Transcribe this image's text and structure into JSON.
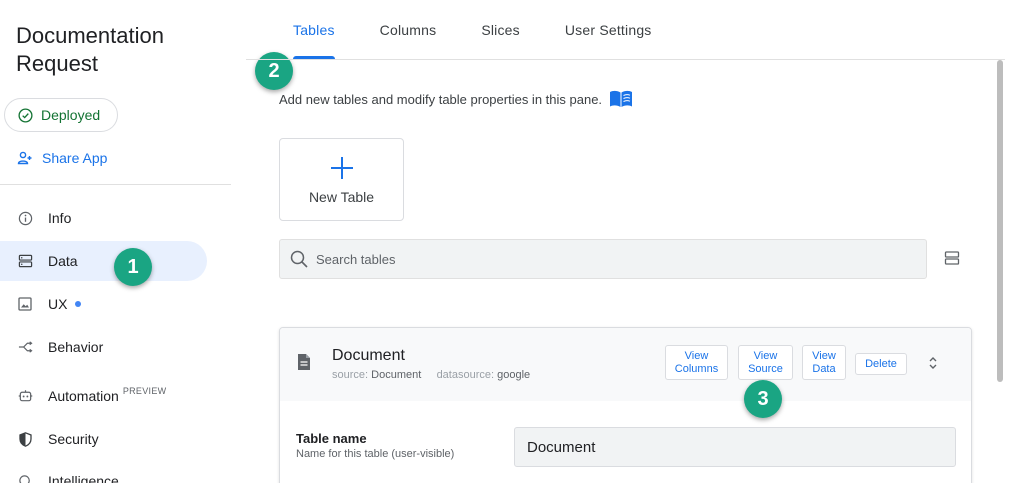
{
  "app": {
    "title": "Documentation Request"
  },
  "sidebar": {
    "status_label": "Deployed",
    "share_label": "Share App",
    "items": [
      {
        "label": "Info",
        "icon": "info-icon"
      },
      {
        "label": "Data",
        "icon": "data-icon",
        "active": true
      },
      {
        "label": "UX",
        "icon": "ux-icon",
        "dot": true
      },
      {
        "label": "Behavior",
        "icon": "behavior-icon"
      },
      {
        "label": "Automation",
        "icon": "automation-icon",
        "tag": "PREVIEW"
      },
      {
        "label": "Security",
        "icon": "security-icon"
      },
      {
        "label": "Intelligence",
        "icon": "intelligence-icon"
      }
    ]
  },
  "tabs": [
    {
      "label": "Tables",
      "active": true
    },
    {
      "label": "Columns"
    },
    {
      "label": "Slices"
    },
    {
      "label": "User Settings"
    }
  ],
  "pane": {
    "description": "Add new tables and modify table properties in this pane.",
    "new_table_label": "New Table",
    "search_placeholder": "Search tables"
  },
  "table_card": {
    "name": "Document",
    "source_label": "source:",
    "source_value": "Document",
    "datasource_label": "datasource:",
    "datasource_value": "google",
    "buttons": {
      "view_columns": [
        "View",
        "Columns"
      ],
      "view_source": [
        "View",
        "Source"
      ],
      "view_data": [
        "View",
        "Data"
      ],
      "delete": "Delete"
    },
    "field": {
      "label": "Table name",
      "hint": "Name for this table (user-visible)",
      "value": "Document"
    }
  },
  "annotations": [
    "1",
    "2",
    "3"
  ],
  "colors": {
    "accent": "#1a73e8",
    "badge": "#1aa583",
    "deployed": "#137333",
    "active_nav_bg": "#e8f0fe"
  }
}
